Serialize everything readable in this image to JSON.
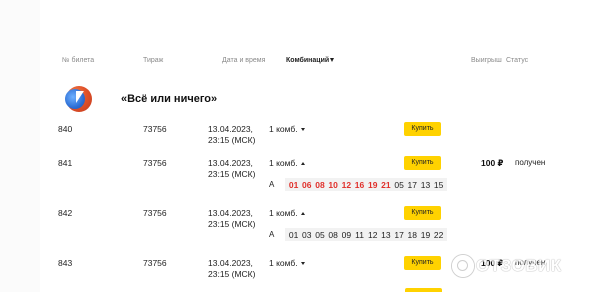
{
  "table": {
    "headers": {
      "ticket": "№ билета",
      "draw": "Тираж",
      "datetime": "Дата и время",
      "combinations": "Комбинаций",
      "win": "Выигрыш",
      "status": "Статус"
    },
    "game": {
      "title": "«Всё или ничего»",
      "logo_icon": "lottery-logo-icon"
    },
    "rows": [
      {
        "ticket": "840",
        "draw": "73756",
        "date": "13.04.2023,",
        "time": "23:15 (МСК)",
        "comb": "1 комб.",
        "comb_caret": "down",
        "buy": "Купить"
      },
      {
        "ticket": "841",
        "draw": "73756",
        "date": "13.04.2023,",
        "time": "23:15 (МСК)",
        "comb": "1 комб.",
        "comb_caret": "up",
        "buy": "Купить",
        "win": "100 ₽",
        "status": "получен",
        "combo": {
          "label": "A",
          "numbers": [
            "01",
            "06",
            "08",
            "10",
            "12",
            "16",
            "19",
            "21",
            "05",
            "17",
            "13",
            "15"
          ],
          "hits": 8
        }
      },
      {
        "ticket": "842",
        "draw": "73756",
        "date": "13.04.2023,",
        "time": "23:15 (МСК)",
        "comb": "1 комб.",
        "comb_caret": "up",
        "buy": "Купить",
        "combo": {
          "label": "A",
          "numbers": [
            "01",
            "03",
            "05",
            "08",
            "09",
            "11",
            "12",
            "13",
            "17",
            "18",
            "19",
            "22"
          ],
          "hits": 0
        }
      },
      {
        "ticket": "843",
        "draw": "73756",
        "date": "13.04.2023,",
        "time": "23:15 (МСК)",
        "comb": "1 комб.",
        "comb_caret": "down",
        "buy": "Купить",
        "win": "100 ₽",
        "status": "получен"
      }
    ]
  },
  "watermark": {
    "text": "ОТЗОВИК",
    "icon": "otzovik-logo-icon"
  },
  "colors": {
    "accent_yellow": "#ffd200",
    "hit_red": "#e0302b"
  }
}
